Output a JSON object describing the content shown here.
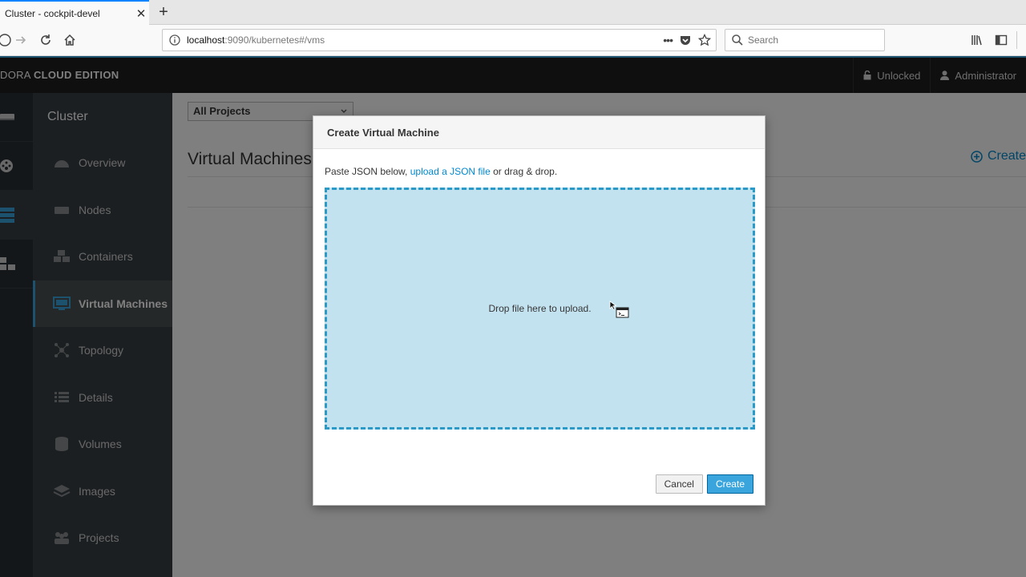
{
  "browser": {
    "tab_title": "Cluster - cockpit-devel",
    "tab_close": "✕",
    "new_tab": "+",
    "url_host": "localhost",
    "url_rest": ":9090/kubernetes#/vms",
    "search_placeholder": "Search",
    "page_actions": "•••"
  },
  "header": {
    "brand_prefix": "DORA ",
    "brand_bold": "CLOUD EDITION",
    "unlocked": "Unlocked",
    "user": "Administrator"
  },
  "secnav": {
    "title": "Cluster",
    "items": [
      {
        "label": "Overview"
      },
      {
        "label": "Nodes"
      },
      {
        "label": "Containers"
      },
      {
        "label": "Virtual Machines"
      },
      {
        "label": "Topology"
      },
      {
        "label": "Details"
      },
      {
        "label": "Volumes"
      },
      {
        "label": "Images"
      },
      {
        "label": "Projects"
      }
    ]
  },
  "main": {
    "project_select": "All Projects",
    "page_title": "Virtual Machines",
    "create_label": "Create"
  },
  "modal": {
    "title": "Create Virtual Machine",
    "intro_prefix": "Paste JSON below, ",
    "intro_link": "upload a JSON file",
    "intro_suffix": " or drag & drop.",
    "drop_text": "Drop file here to upload.",
    "cancel_label": "Cancel",
    "create_label": "Create"
  },
  "colors": {
    "accent": "#39a5dc",
    "link": "#0088ce",
    "dropzone_fill": "#c3e2f0",
    "header_bg": "#1f1f1f",
    "nav_bg": "#393f44"
  }
}
